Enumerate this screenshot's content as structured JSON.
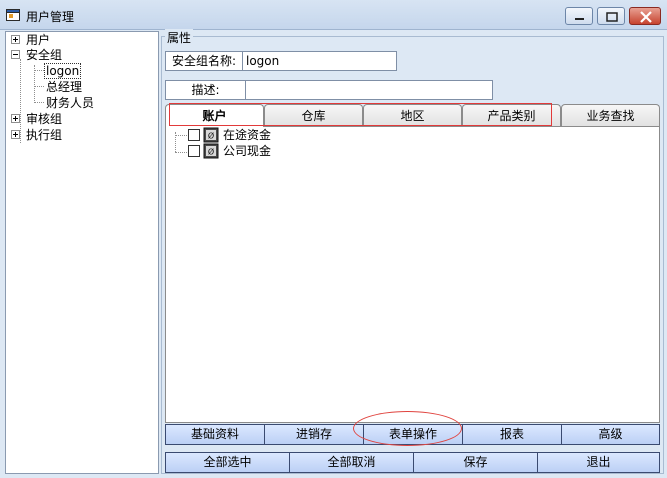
{
  "window": {
    "title": "用户管理"
  },
  "tree": {
    "nodes": [
      {
        "label": "用户",
        "expander": "plus"
      },
      {
        "label": "安全组",
        "expander": "minus"
      },
      {
        "label": "logon"
      },
      {
        "label": "总经理"
      },
      {
        "label": "财务人员"
      },
      {
        "label": "审核组",
        "expander": "plus"
      },
      {
        "label": "执行组",
        "expander": "plus"
      }
    ]
  },
  "properties": {
    "group_title": "属性",
    "name_label": "安全组名称:",
    "name_value": "logon",
    "desc_label": "描述:",
    "desc_value": ""
  },
  "tabs": [
    {
      "label": "账户",
      "active": true
    },
    {
      "label": "仓库"
    },
    {
      "label": "地区"
    },
    {
      "label": "产品类别"
    },
    {
      "label": "业务查找"
    }
  ],
  "items": [
    {
      "label": "在途资金"
    },
    {
      "label": "公司现金"
    }
  ],
  "module_buttons": [
    "基础资料",
    "进销存",
    "表单操作",
    "报表",
    "高级"
  ],
  "action_buttons": [
    "全部选中",
    "全部取消",
    "保存",
    "退出"
  ],
  "colors": {
    "highlight": "#e23a3a",
    "button_fill": "#c8d9fa"
  }
}
